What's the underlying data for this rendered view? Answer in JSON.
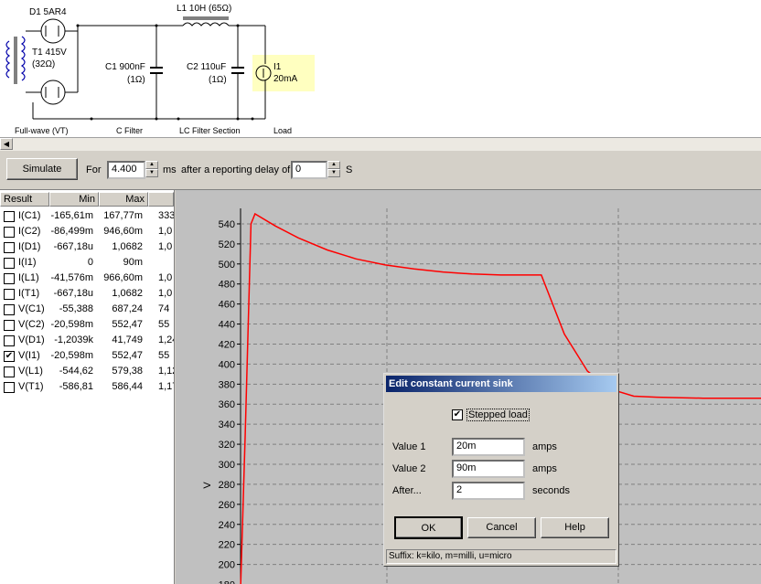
{
  "schematic": {
    "d1_label": "D1 5AR4",
    "l1_label": "L1 10H (65Ω)",
    "t1_label": "T1 415V",
    "t1_res": "(32Ω)",
    "c1_label": "C1 900nF",
    "c1_res": "(1Ω)",
    "c2_label": "C2 110uF",
    "c2_res": "(1Ω)",
    "i1_label": "I1",
    "i1_value": "20mA",
    "sections": [
      "Full-wave (VT)",
      "C Filter",
      "LC Filter Section",
      "Load"
    ]
  },
  "toolbar": {
    "simulate_label": "Simulate",
    "for_label": "For",
    "duration_value": "4.400",
    "duration_unit": "ms",
    "delay_label": "after a reporting delay of",
    "delay_value": "0",
    "delay_unit": "S"
  },
  "results": {
    "headers": [
      "Result",
      "Min",
      "Max"
    ],
    "rows": [
      {
        "name": "I(C1)",
        "min": "-165,61m",
        "max": "167,77m",
        "extra": "333,",
        "checked": false
      },
      {
        "name": "I(C2)",
        "min": "-86,499m",
        "max": "946,60m",
        "extra": "1,0",
        "checked": false
      },
      {
        "name": "I(D1)",
        "min": "-667,18u",
        "max": "1,0682",
        "extra": "1,0",
        "checked": false
      },
      {
        "name": "I(I1)",
        "min": "0",
        "max": "90m",
        "extra": "",
        "checked": false
      },
      {
        "name": "I(L1)",
        "min": "-41,576m",
        "max": "966,60m",
        "extra": "1,0",
        "checked": false
      },
      {
        "name": "I(T1)",
        "min": "-667,18u",
        "max": "1,0682",
        "extra": "1,0",
        "checked": false
      },
      {
        "name": "V(C1)",
        "min": "-55,388",
        "max": "687,24",
        "extra": "74",
        "checked": false
      },
      {
        "name": "V(C2)",
        "min": "-20,598m",
        "max": "552,47",
        "extra": "55",
        "checked": false
      },
      {
        "name": "V(D1)",
        "min": "-1,2039k",
        "max": "41,749",
        "extra": "1,24",
        "checked": false
      },
      {
        "name": "V(I1)",
        "min": "-20,598m",
        "max": "552,47",
        "extra": "55",
        "checked": true
      },
      {
        "name": "V(L1)",
        "min": "-544,62",
        "max": "579,38",
        "extra": "1,12",
        "checked": false
      },
      {
        "name": "V(T1)",
        "min": "-586,81",
        "max": "586,44",
        "extra": "1,17",
        "checked": false
      }
    ]
  },
  "chart_data": {
    "type": "line",
    "ylabel": "V",
    "yticks": [
      540,
      520,
      500,
      480,
      460,
      440,
      420,
      400,
      380,
      360,
      340,
      320,
      300,
      280,
      260,
      240,
      220,
      200,
      180
    ],
    "ylim": [
      175,
      550
    ],
    "grid": true,
    "series": [
      {
        "color": "#ff0000",
        "points": [
          [
            0,
            175
          ],
          [
            0.08,
            330
          ],
          [
            0.18,
            540
          ],
          [
            0.25,
            550
          ],
          [
            0.6,
            538
          ],
          [
            1.0,
            526
          ],
          [
            1.5,
            514
          ],
          [
            2.0,
            505
          ],
          [
            2.5,
            499
          ],
          [
            3.0,
            495
          ],
          [
            3.5,
            492
          ],
          [
            4.0,
            490
          ],
          [
            4.5,
            489
          ],
          [
            5.0,
            489
          ],
          [
            5.2,
            489
          ],
          [
            5.6,
            430
          ],
          [
            6.0,
            393
          ],
          [
            6.4,
            375
          ],
          [
            6.8,
            368
          ],
          [
            7.2,
            367
          ],
          [
            8.0,
            366
          ],
          [
            9.0,
            366
          ]
        ]
      }
    ],
    "xlim": [
      0,
      9.0
    ]
  },
  "dialog": {
    "title": "Edit constant current sink",
    "checkbox_label": "Stepped load",
    "checkbox_checked": "✔",
    "value1_label": "Value 1",
    "value1": "20m",
    "value1_unit": "amps",
    "value2_label": "Value 2",
    "value2": "90m",
    "value2_unit": "amps",
    "after_label": "After...",
    "after_value": "2",
    "after_unit": "seconds",
    "ok_label": "OK",
    "cancel_label": "Cancel",
    "help_label": "Help",
    "status": "Suffix: k=kilo, m=milli, u=micro"
  }
}
